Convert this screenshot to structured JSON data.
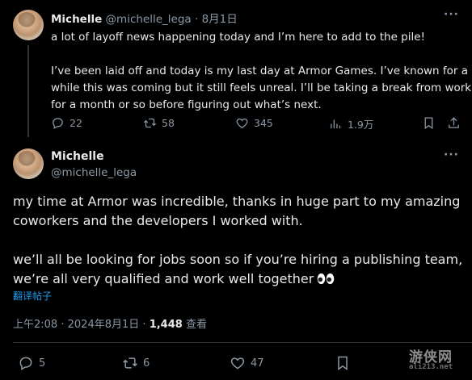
{
  "tweet1": {
    "author_name": "Michelle",
    "handle": "@michelle_lega",
    "separator": "·",
    "date": "8月1日",
    "lines": [
      "a lot of layoff news happening today and I’m here to add to the pile!",
      "I’ve been laid off and today is my last day at Armor Games. I’ve known for a",
      "while this was coming but it still feels unreal. I’ll be taking a break from work",
      "for a month or so before figuring out what’s next."
    ],
    "stats": {
      "replies": "22",
      "retweets": "58",
      "likes": "345",
      "views": "1.9万"
    }
  },
  "tweet2": {
    "author_name": "Michelle",
    "handle": "@michelle_lega",
    "lines": [
      "my time at Armor was incredible, thanks in huge part to my amazing",
      "coworkers and the developers I worked with.",
      "we’ll all be looking for jobs soon so if you’re hiring a publishing team,",
      "we’re all very qualified and work well together"
    ],
    "translate_label": "翻译帖子",
    "time": "上午2:08",
    "dot": "·",
    "date": "2024年8月1日",
    "views_count": "1,448",
    "views_label": "查看",
    "stats": {
      "replies": "5",
      "retweets": "6",
      "likes": "47"
    }
  },
  "watermark": {
    "text": "游侠网",
    "sub": "ali213.net"
  },
  "colors": {
    "background": "#000000",
    "text": "#e7e9ea",
    "muted": "#8b98a5",
    "link": "#1d9bf0",
    "divider": "#2f3336"
  }
}
